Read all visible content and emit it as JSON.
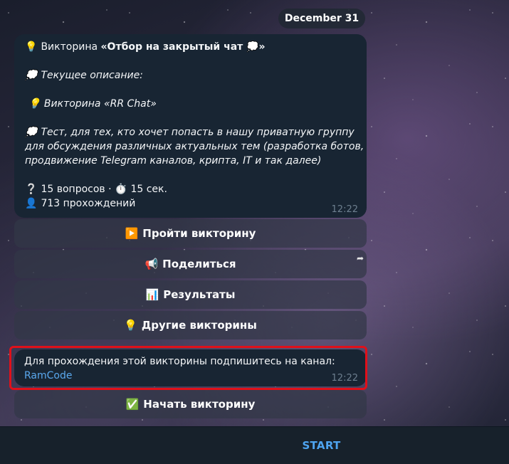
{
  "date_label": "December 31",
  "quiz": {
    "title_prefix": "Викторина ",
    "title_bold": "«Отбор на закрытый чат 💭»",
    "current_desc_label": "Текущее описание:",
    "inner_title": "Викторина «RR Chat»",
    "desc_lines": [
      "Тест, для тех, кто хочет попасть в нашу приватную группу",
      "для обсуждения различных актуальных тем (разработка ботов,",
      "продвижение Telegram каналов, крипта, IT и так далее)"
    ],
    "questions": "15 вопросов",
    "separator": "·",
    "seconds": "15 сек.",
    "completions": "713 прохождений",
    "time": "12:22"
  },
  "buttons": [
    {
      "icon": "▶️",
      "label": "Пройти викторину"
    },
    {
      "icon": "📢",
      "label": "Поделиться"
    },
    {
      "icon": "📊",
      "label": "Результаты"
    },
    {
      "icon": "💡",
      "label": "Другие викторины"
    }
  ],
  "notice": {
    "text": "Для прохождения этой викторины подпишитесь на канал:",
    "link": "RamCode",
    "time": "12:22"
  },
  "start_quiz": {
    "icon": "✅",
    "label": "Начать викторину"
  },
  "bottom": {
    "start_label": "START"
  },
  "icons": {
    "bulb": "💡",
    "thought": "💭",
    "question": "❔",
    "stopwatch": "⏱️",
    "user": "👤",
    "share": "➦"
  },
  "colors": {
    "bubble": "#182533",
    "link": "#5aa8ee",
    "highlight": "#e0101a",
    "start": "#4ea4f0"
  }
}
